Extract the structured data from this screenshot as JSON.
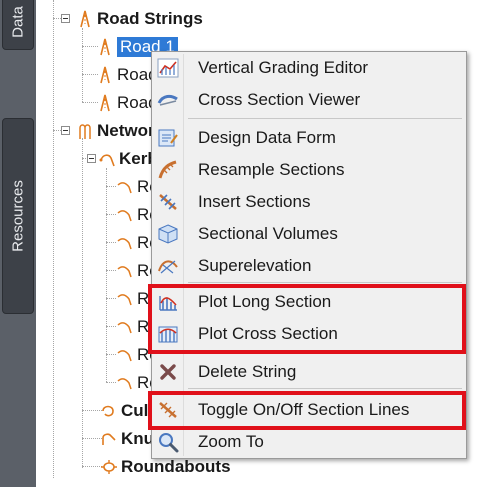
{
  "side_tabs": {
    "data": "Data",
    "resources": "Resources"
  },
  "tree": {
    "road_strings": "Road Strings",
    "road_1": "Road 1",
    "road_2": "Road",
    "road_3": "Road",
    "networks": "Network",
    "kerbs": "Kerb",
    "kerb_items": [
      "Ro",
      "Ro",
      "Ro",
      "Ro",
      "Ro",
      "Ro",
      "Ro",
      "Ro"
    ],
    "cul": "Cul-",
    "knu": "Knu",
    "roundabouts": "Roundabouts"
  },
  "menu": {
    "items": [
      {
        "label": "Vertical Grading Editor",
        "icon": "vertical-grading-icon"
      },
      {
        "label": "Cross Section Viewer",
        "icon": "cross-section-viewer-icon"
      },
      {
        "label": "Design Data Form",
        "icon": "design-data-form-icon"
      },
      {
        "label": "Resample Sections",
        "icon": "resample-sections-icon"
      },
      {
        "label": "Insert Sections",
        "icon": "insert-sections-icon"
      },
      {
        "label": "Sectional Volumes",
        "icon": "sectional-volumes-icon"
      },
      {
        "label": "Superelevation",
        "icon": "superelevation-icon"
      },
      {
        "label": "Plot Long Section",
        "icon": "plot-long-section-icon"
      },
      {
        "label": "Plot Cross Section",
        "icon": "plot-cross-section-icon"
      },
      {
        "label": "Delete String",
        "icon": "delete-string-icon"
      },
      {
        "label": "Toggle On/Off Section Lines",
        "icon": "toggle-section-lines-icon"
      },
      {
        "label": "Zoom To",
        "icon": "zoom-to-icon"
      }
    ]
  },
  "colors": {
    "highlight": "#e0101a",
    "selection": "#2e7ad6",
    "sidebar": "#5b6068"
  }
}
